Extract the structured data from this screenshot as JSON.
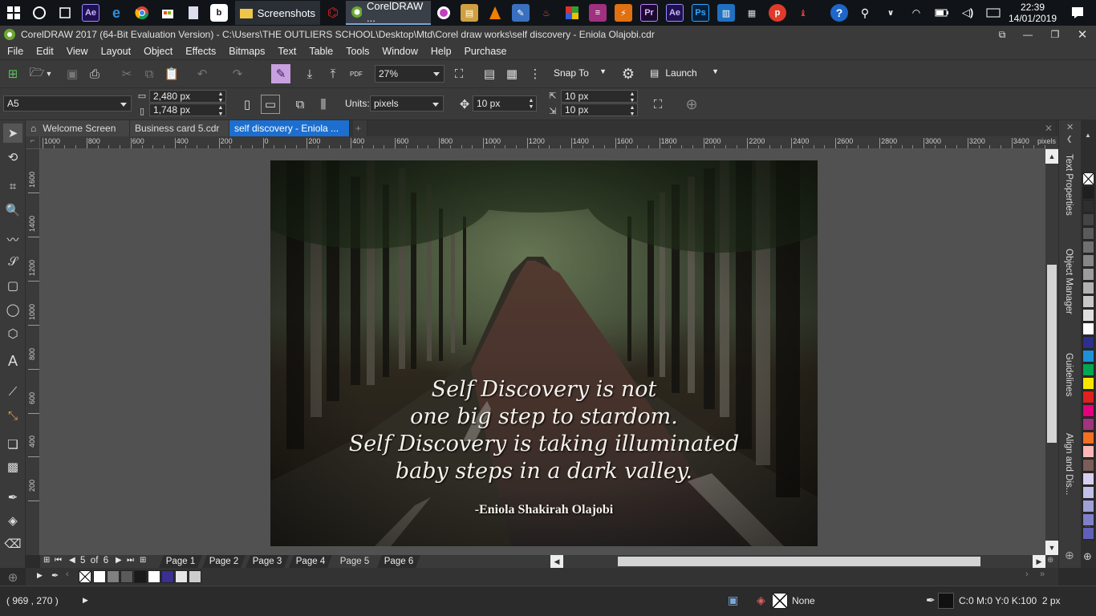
{
  "taskbar": {
    "screenshots_label": "Screenshots",
    "coreldraw_label": "CorelDRAW ...",
    "time": "22:39",
    "date": "14/01/2019"
  },
  "window": {
    "title": "CorelDRAW 2017 (64-Bit Evaluation Version) - C:\\Users\\THE OUTLIERS SCHOOL\\Desktop\\Mtd\\Corel draw works\\self discovery - Eniola Olajobi.cdr"
  },
  "menu": [
    "File",
    "Edit",
    "View",
    "Layout",
    "Object",
    "Effects",
    "Bitmaps",
    "Text",
    "Table",
    "Tools",
    "Window",
    "Help",
    "Purchase"
  ],
  "standard": {
    "zoom": "27%",
    "snap_to": "Snap To",
    "launch": "Launch"
  },
  "properties": {
    "page_size": "A5",
    "width": "2,480 px",
    "height": "1,748 px",
    "units_label": "Units:",
    "units": "pixels",
    "nudge": "10 px",
    "dup_x": "10 px",
    "dup_y": "10 px"
  },
  "tabs": [
    "Welcome Screen",
    "Business card 5.cdr",
    "self discovery - Eniola ..."
  ],
  "ruler": {
    "h_ticks": [
      "1000",
      "800",
      "600",
      "400",
      "200",
      "0",
      "200",
      "400",
      "600",
      "800",
      "1000",
      "1200",
      "1400",
      "1600",
      "1800",
      "2000",
      "2200",
      "2400",
      "2600",
      "2800",
      "3000",
      "3200",
      "3400"
    ],
    "h_unit": "pixels",
    "v_ticks": [
      "1600",
      "1400",
      "1200",
      "1000",
      "800",
      "600",
      "400",
      "200"
    ]
  },
  "artwork": {
    "quote_lines": [
      "Self Discovery is not",
      "one big step to stardom.",
      "Self Discovery is taking illuminated",
      "baby steps in a dark valley."
    ],
    "author": "-Eniola Shakirah Olajobi"
  },
  "pager": {
    "current": "5",
    "of_label": "of",
    "total": "6",
    "pages": [
      "Page 1",
      "Page 2",
      "Page 3",
      "Page 4",
      "Page 5",
      "Page 6"
    ]
  },
  "dockers": [
    "Text Properties",
    "Object Manager",
    "Guidelines",
    "Align and Dis..."
  ],
  "status": {
    "coords": "( 969 , 270 )",
    "fill": "None",
    "outline": "C:0 M:0 Y:0 K:100  2 px"
  },
  "palette_colors": [
    "#1f1f1f",
    "#2e2e2e",
    "#444444",
    "#5a5a5a",
    "#707070",
    "#868686",
    "#9c9c9c",
    "#b2b2b2",
    "#c8c8c8",
    "#dedede",
    "#ffffff",
    "#2e2e8c",
    "#1e90d8",
    "#00a651",
    "#f7e400",
    "#e0201e",
    "#e4007c",
    "#a0347e",
    "#f36f21",
    "#ffb6b6",
    "#7a5c58",
    "#d8d0f0",
    "#c0c0e8",
    "#a0a0d8",
    "#8080c8",
    "#6060b8"
  ],
  "doc_palette": [
    "#ffffff",
    "#7f7f7f",
    "#5a5a5a",
    "#1a1a1a",
    "#ffffff",
    "#3a3090",
    "#e6e6e6",
    "#cccccc"
  ]
}
